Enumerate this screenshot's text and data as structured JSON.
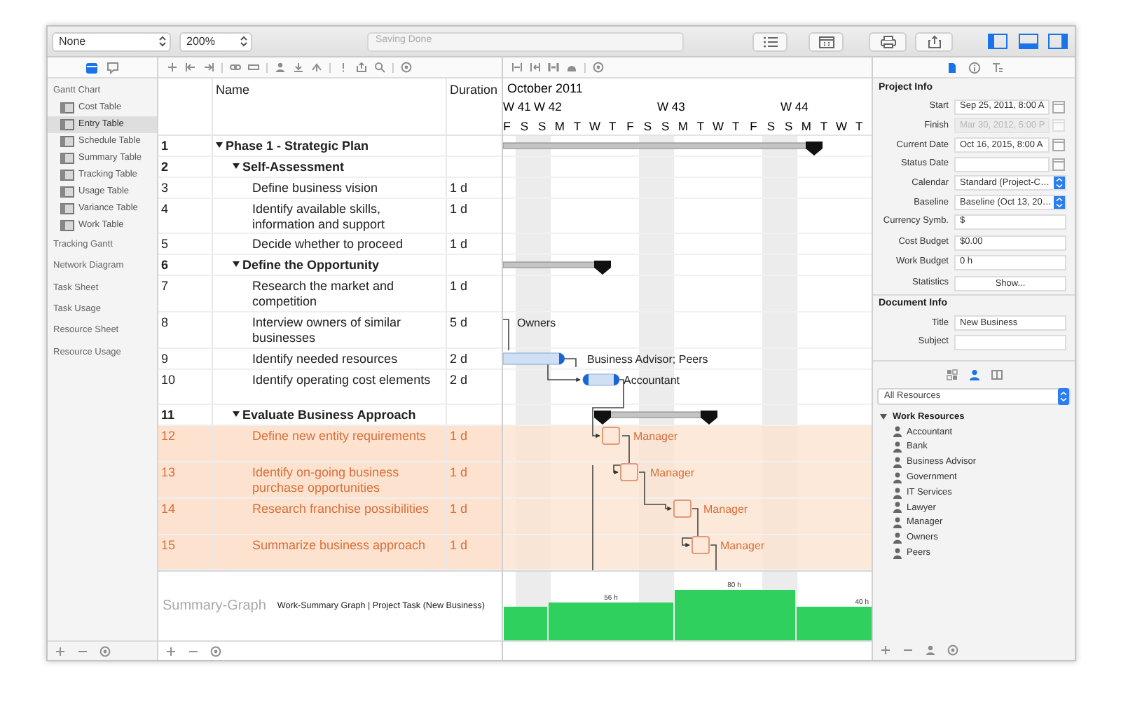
{
  "toolbar": {
    "view_filter": "None",
    "zoom": "200%",
    "status": "Saving Done"
  },
  "sidebar": {
    "tabs": [
      {
        "kind": "calendar",
        "selected": true
      },
      {
        "kind": "comment",
        "selected": false
      }
    ],
    "views": [
      {
        "label": "Gantt Chart",
        "selected": false,
        "children": [
          {
            "label": "Cost Table",
            "selected": false
          },
          {
            "label": "Entry Table",
            "selected": true
          },
          {
            "label": "Schedule Table",
            "selected": false
          },
          {
            "label": "Summary Table",
            "selected": false
          },
          {
            "label": "Tracking Table",
            "selected": false
          },
          {
            "label": "Usage Table",
            "selected": false
          },
          {
            "label": "Variance Table",
            "selected": false
          },
          {
            "label": "Work Table",
            "selected": false
          }
        ]
      },
      {
        "label": "Tracking Gantt",
        "selected": false
      },
      {
        "label": "Network Diagram",
        "selected": false
      },
      {
        "label": "Task Sheet",
        "selected": false
      },
      {
        "label": "Task Usage",
        "selected": false
      },
      {
        "label": "Resource Sheet",
        "selected": false
      },
      {
        "label": "Resource Usage",
        "selected": false
      }
    ]
  },
  "table": {
    "columns": [
      "Name",
      "Duration"
    ],
    "rows": [
      {
        "number": "1",
        "name": "Phase 1 - Strategic Plan",
        "kind": "summary",
        "expanded": true,
        "selected": false,
        "children": [
          {
            "number": "2",
            "name": "Self-Assessment",
            "kind": "summary",
            "expanded": true,
            "selected": false,
            "children": [
              {
                "number": "3",
                "name": "Define business vision",
                "duration": "1 d",
                "kind": "task",
                "selected": false
              },
              {
                "number": "4",
                "name": "Identify available skills, information and support",
                "duration": "1 d",
                "kind": "task",
                "selected": false
              },
              {
                "number": "5",
                "name": "Decide whether to proceed",
                "duration": "1 d",
                "kind": "task",
                "selected": false
              }
            ]
          },
          {
            "number": "6",
            "name": "Define the Opportunity",
            "kind": "summary",
            "expanded": true,
            "selected": false,
            "children": [
              {
                "number": "7",
                "name": "Research the market and competition",
                "duration": "1 d",
                "kind": "task",
                "selected": false
              },
              {
                "number": "8",
                "name": "Interview owners of similar businesses",
                "duration": "5 d",
                "kind": "task",
                "selected": false,
                "resources": "Owners"
              },
              {
                "number": "9",
                "name": "Identify needed resources",
                "duration": "2 d",
                "kind": "task",
                "selected": false,
                "resources": "Business Advisor; Peers"
              },
              {
                "number": "10",
                "name": "Identify operating cost elements",
                "duration": "2 d",
                "kind": "task",
                "selected": false,
                "resources": "Accountant"
              }
            ]
          },
          {
            "number": "11",
            "name": "Evaluate Business Approach",
            "kind": "summary",
            "expanded": true,
            "selected": false,
            "children": [
              {
                "number": "12",
                "name": "Define new entity requirements",
                "duration": "1 d",
                "kind": "task",
                "selected": true,
                "resources": "Manager"
              },
              {
                "number": "13",
                "name": "Identify on-going business purchase opportunities",
                "duration": "1 d",
                "kind": "task",
                "selected": true,
                "resources": "Manager"
              },
              {
                "number": "14",
                "name": "Research franchise possibilities",
                "duration": "1 d",
                "kind": "task",
                "selected": true,
                "resources": "Manager"
              },
              {
                "number": "15",
                "name": "Summarize business approach",
                "duration": "1 d",
                "kind": "task",
                "selected": true,
                "resources": "Manager"
              }
            ]
          }
        ]
      }
    ]
  },
  "gantt": {
    "month": "October 2011",
    "weeks": [
      "W 41",
      "W 42",
      "W 43",
      "W 44"
    ],
    "days": [
      "F",
      "S",
      "S",
      "M",
      "T",
      "W",
      "T",
      "F",
      "S",
      "S",
      "M",
      "T",
      "W",
      "T",
      "F",
      "S",
      "S",
      "M",
      "T",
      "W",
      "T"
    ]
  },
  "summary_graph": {
    "title": "Summary-Graph",
    "caption": "Work-Summary Graph | Project Task (New Business)",
    "bar_labels": [
      "56 h",
      "80 h",
      "40 h"
    ]
  },
  "inspector": {
    "tabs": [
      {
        "kind": "document",
        "selected": true
      },
      {
        "kind": "info",
        "selected": false
      },
      {
        "kind": "style",
        "selected": false
      }
    ],
    "project_info": {
      "title": "Project Info",
      "field_groups": [
        [
          {
            "label": "Start",
            "kind": "date",
            "value": "Sep 25, 2011, 8:00 A",
            "disabled": false
          },
          {
            "label": "Finish",
            "kind": "date",
            "value": "Mar 30, 2012, 5:00 P",
            "disabled": true
          },
          {
            "label": "Current Date",
            "kind": "date",
            "value": "Oct 16, 2015, 8:00 A",
            "disabled": false
          },
          {
            "label": "Status Date",
            "kind": "date",
            "disabled": false
          },
          {
            "label": "Calendar",
            "kind": "select",
            "value": "Standard (Project-C…",
            "disabled": false
          },
          {
            "label": "Baseline",
            "kind": "select",
            "value": "Baseline (Oct 13, 20…",
            "disabled": false
          },
          {
            "label": "Currency Symb.",
            "kind": "text",
            "value": "$",
            "disabled": false
          }
        ],
        [
          {
            "label": "Cost Budget",
            "kind": "text",
            "value": "$0.00",
            "disabled": false
          },
          {
            "label": "Work Budget",
            "kind": "text",
            "value": "0 h",
            "disabled": false
          }
        ],
        [
          {
            "label": "Statistics",
            "kind": "button",
            "value": "Show...",
            "disabled": false
          }
        ]
      ]
    },
    "document_info": {
      "title": "Document Info",
      "fields": [
        {
          "label": "Title",
          "kind": "text",
          "value": "New Business",
          "disabled": false
        },
        {
          "label": "Subject",
          "kind": "text",
          "disabled": false
        }
      ]
    },
    "resource_tabs": [
      {
        "kind": "grid",
        "selected": false
      },
      {
        "kind": "person",
        "selected": true
      },
      {
        "kind": "columns",
        "selected": false
      }
    ],
    "resource_filter": "All Resources",
    "resources": [
      {
        "label": "Work Resources",
        "expanded": true,
        "children": [
          {
            "label": "Accountant"
          },
          {
            "label": "Bank"
          },
          {
            "label": "Business Advisor"
          },
          {
            "label": "Government"
          },
          {
            "label": "IT Services"
          },
          {
            "label": "Lawyer"
          },
          {
            "label": "Manager"
          },
          {
            "label": "Owners"
          },
          {
            "label": "Peers"
          }
        ]
      }
    ]
  }
}
